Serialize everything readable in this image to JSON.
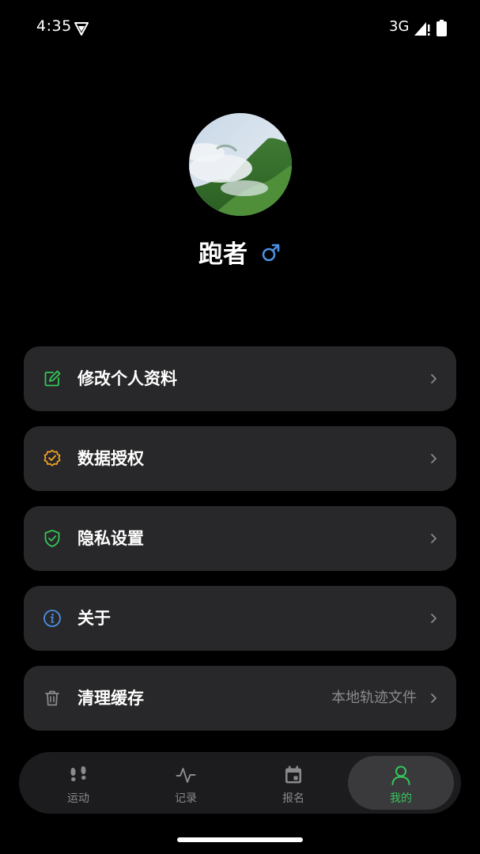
{
  "status_bar": {
    "time": "4:35",
    "network": "3G"
  },
  "profile": {
    "name": "跑者",
    "gender_symbol": "♂",
    "gender_color": "#4a90e2"
  },
  "menu": {
    "items": [
      {
        "label": "修改个人资料",
        "icon": "edit-icon",
        "icon_color": "#34c759"
      },
      {
        "label": "数据授权",
        "icon": "verified-badge-icon",
        "icon_color": "#f5a623"
      },
      {
        "label": "隐私设置",
        "icon": "shield-check-icon",
        "icon_color": "#34c759"
      },
      {
        "label": "关于",
        "icon": "info-icon",
        "icon_color": "#4a90e2"
      },
      {
        "label": "清理缓存",
        "value": "本地轨迹文件",
        "icon": "trash-icon",
        "icon_color": "#8a8a8e"
      }
    ]
  },
  "nav": {
    "items": [
      {
        "label": "运动",
        "icon": "footprints-icon"
      },
      {
        "label": "记录",
        "icon": "activity-icon"
      },
      {
        "label": "报名",
        "icon": "calendar-icon"
      },
      {
        "label": "我的",
        "icon": "user-icon",
        "active": true
      }
    ],
    "active_color": "#34c759"
  }
}
